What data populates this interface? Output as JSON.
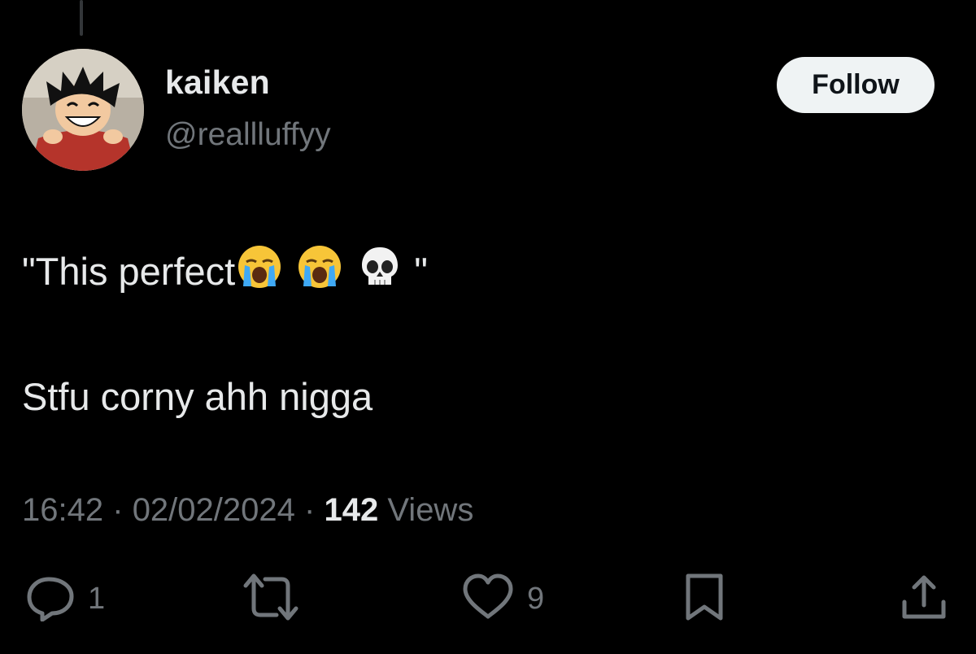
{
  "tweet": {
    "author_name": "kaiken",
    "author_handle": "@reallluffyy",
    "follow_label": "Follow",
    "line1_text_start": "\"This perfect",
    "line1_text_end": "\"",
    "emojis": [
      "loudly-crying-face",
      "loudly-crying-face",
      "skull"
    ],
    "line2_text": "Stfu corny ahh nigga",
    "time": "16:42",
    "date": "02/02/2024",
    "separator": "·",
    "views_count": "142",
    "views_label": "Views"
  },
  "actions": {
    "replies": "1",
    "retweets": "",
    "likes": "9"
  },
  "colors": {
    "background": "#000000",
    "primary_text": "#e7e9ea",
    "secondary_text": "#71767b",
    "follow_bg": "#eff3f4",
    "follow_text": "#0f1419"
  },
  "icons": [
    "reply-icon",
    "retweet-icon",
    "like-icon",
    "bookmark-icon",
    "share-icon"
  ]
}
